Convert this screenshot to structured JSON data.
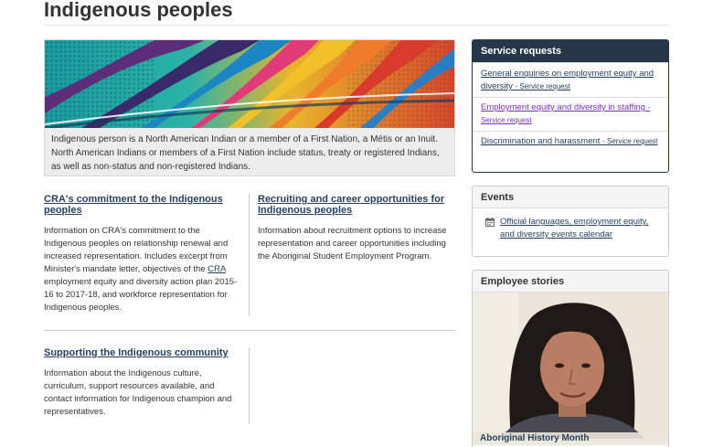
{
  "page": {
    "title": "Indigenous peoples"
  },
  "hero": {
    "caption": "Indigenous person is a North American Indian or a member of a First Nation, a Métis or an Inuit. North American Indians or members of a First Nation include status, treaty or registered Indians, as well as non-status and non-registered Indians."
  },
  "sections": [
    {
      "title": "CRA's commitment to the Indigenous peoples",
      "body_before": "Information on CRA's commitment to the Indigenous peoples on relationship renewal and increased representation. Includes excerpt from Minister's mandate letter, objectives of the ",
      "body_link": "CRA",
      "body_after": " employment equity and diversity action plan 2015-16 to 2017-18, and workforce representation for Indigenous peoples."
    },
    {
      "title": "Recruiting and career opportunities for Indigenous peoples",
      "body": "Information about recruitment options to increase representation and career opportunities including the Aboriginal Student Employment Program."
    },
    {
      "title": "Supporting the Indigenous community",
      "body": "Information about the Indigenous culture, curriculum, support resources available, and contact information for Indigenous champion and representatives."
    }
  ],
  "service_requests": {
    "heading": "Service requests",
    "items": [
      {
        "label": "General enquiries on employment equity and diversity",
        "tag": "- Service request",
        "visited": false
      },
      {
        "label": "Employment equity and diversity in staffing",
        "tag": "- Service request",
        "visited": true
      },
      {
        "label": "Discrimination and harassment",
        "tag": "- Service request",
        "visited": false
      }
    ]
  },
  "events": {
    "heading": "Events",
    "icon": "calendar-icon",
    "link": "Official languages, employment equity, and diversity events calendar"
  },
  "employee_stories": {
    "heading": "Employee stories",
    "caption": "Aboriginal History Month"
  },
  "colors": {
    "link": "#284162",
    "visited": "#7834bc",
    "panel_primary": "#26374a",
    "text": "#333333"
  }
}
